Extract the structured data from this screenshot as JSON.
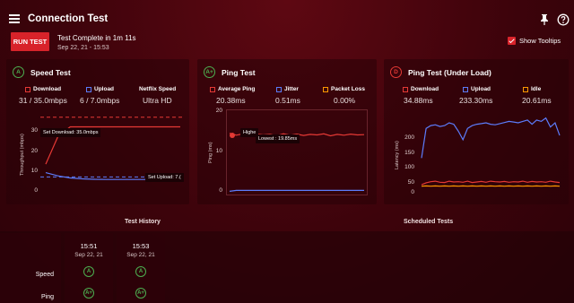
{
  "app": {
    "title": "Connection Test"
  },
  "toolbar": {
    "run_label": "RUN TEST",
    "status": "Test Complete in 1m 11s",
    "timestamp": "Sep 22, 21 - 15:53",
    "tooltips_label": "Show Tooltips",
    "tooltips_checked": true
  },
  "speed_test": {
    "grade": "A",
    "title": "Speed Test",
    "legend": [
      {
        "label": "Download",
        "color": "#e53935",
        "value": "31 / 35.0mbps"
      },
      {
        "label": "Upload",
        "color": "#5c7cfa",
        "value": "6 / 7.0mbps"
      },
      {
        "label": "Netflix Speed",
        "color": "",
        "value": "Ultra HD"
      }
    ],
    "ylabel": "Throughput (mbps)",
    "yticks": [
      "30",
      "20",
      "10",
      "0"
    ],
    "tip_download": "Set Download: 35.0mbps",
    "tip_upload": "Set Upload: 7.(",
    "chart_data": {
      "type": "line",
      "ylim": [
        0,
        37
      ],
      "series": [
        {
          "name": "Download",
          "color": "#e53935",
          "values": [
            13,
            26,
            30.5,
            30.5,
            30.5,
            30.5,
            30.5,
            30.5,
            30.5,
            30.5,
            30.5,
            30.5
          ]
        },
        {
          "name": "Upload",
          "color": "#5c7cfa",
          "values": [
            9,
            7.5,
            6.5,
            6.1,
            5.9,
            5.8,
            5.8,
            5.8,
            5.8,
            5.8,
            5.8,
            5.8
          ]
        }
      ],
      "reference_lines": [
        {
          "name": "Set Download",
          "value": 35,
          "color": "#e53935"
        },
        {
          "name": "Set Upload",
          "value": 7,
          "color": "#5c7cfa"
        }
      ]
    }
  },
  "ping_test": {
    "grade": "A+",
    "title": "Ping Test",
    "legend": [
      {
        "label": "Average Ping",
        "color": "#e53935",
        "value": "20.38ms"
      },
      {
        "label": "Jitter",
        "color": "#5c7cfa",
        "value": "0.51ms"
      },
      {
        "label": "Packet Loss",
        "color": "#ff9800",
        "value": "0.00%"
      }
    ],
    "ylabel": "Ping (ms)",
    "yticks": [
      "20",
      "10",
      "0"
    ],
    "tip_highest": "Highe",
    "tip_lowest": "Lowest : 19.85ms",
    "chart_data": {
      "type": "line",
      "ylim": [
        0,
        28
      ],
      "series": [
        {
          "name": "Ping",
          "color": "#e53935",
          "values": [
            20.8,
            20.1,
            20.6,
            19.9,
            20.5,
            20.2,
            20.4,
            19.9,
            20.6,
            20.1,
            20.5,
            20.0,
            20.4,
            20.2,
            20.6,
            19.9,
            20.4,
            20.1,
            20.5,
            20.2,
            20.3
          ]
        },
        {
          "name": "Jitter",
          "color": "#5c7cfa",
          "values": [
            0.2,
            0.5,
            0.5,
            0.5,
            0.5,
            0.5,
            0.5,
            0.5,
            0.5,
            0.5,
            0.5,
            0.5,
            0.5,
            0.5,
            0.5,
            0.5,
            0.5,
            0.5,
            0.5,
            0.5,
            0.5
          ]
        }
      ]
    }
  },
  "ping_load": {
    "grade": "D",
    "title": "Ping Test (Under Load)",
    "legend": [
      {
        "label": "Download",
        "color": "#e53935",
        "value": "34.88ms"
      },
      {
        "label": "Upload",
        "color": "#5c7cfa",
        "value": "233.30ms"
      },
      {
        "label": "Idle",
        "color": "#ff9800",
        "value": "20.61ms"
      }
    ],
    "ylabel": "Latency (ms)",
    "yticks": [
      "200",
      "150",
      "100",
      "50",
      "0"
    ],
    "chart_data": {
      "type": "line",
      "ylim": [
        0,
        280
      ],
      "series": [
        {
          "name": "Upload",
          "color": "#5c7cfa",
          "values": [
            120,
            225,
            235,
            238,
            232,
            235,
            245,
            240,
            215,
            185,
            225,
            235,
            240,
            242,
            245,
            240,
            238,
            242,
            246,
            250,
            248,
            245,
            250,
            255,
            240,
            255,
            250,
            262,
            230,
            245,
            200
          ]
        },
        {
          "name": "Download",
          "color": "#e53935",
          "values": [
            25,
            32,
            36,
            38,
            34,
            33,
            38,
            35,
            36,
            34,
            38,
            33,
            35,
            37,
            34,
            38,
            36,
            35,
            37,
            34,
            36,
            35,
            38,
            34,
            37,
            35,
            36,
            34,
            38,
            35,
            33
          ]
        },
        {
          "name": "Idle",
          "color": "#ff9800",
          "values": [
            20,
            21,
            20,
            21,
            20,
            21,
            20,
            21,
            20,
            21,
            20,
            21,
            20,
            21,
            20,
            21,
            20,
            21,
            20,
            21,
            20,
            21,
            20,
            21,
            20,
            21,
            20,
            21,
            20,
            21,
            20
          ]
        }
      ]
    }
  },
  "sections": {
    "history": "Test History",
    "scheduled": "Scheduled Tests"
  },
  "history": {
    "row_labels": [
      "Speed",
      "Ping"
    ],
    "columns": [
      {
        "time": "15:51",
        "date": "Sep 22, 21",
        "speed": "A",
        "ping": "A+"
      },
      {
        "time": "15:53",
        "date": "Sep 22, 21",
        "speed": "A",
        "ping": "A+"
      }
    ]
  }
}
